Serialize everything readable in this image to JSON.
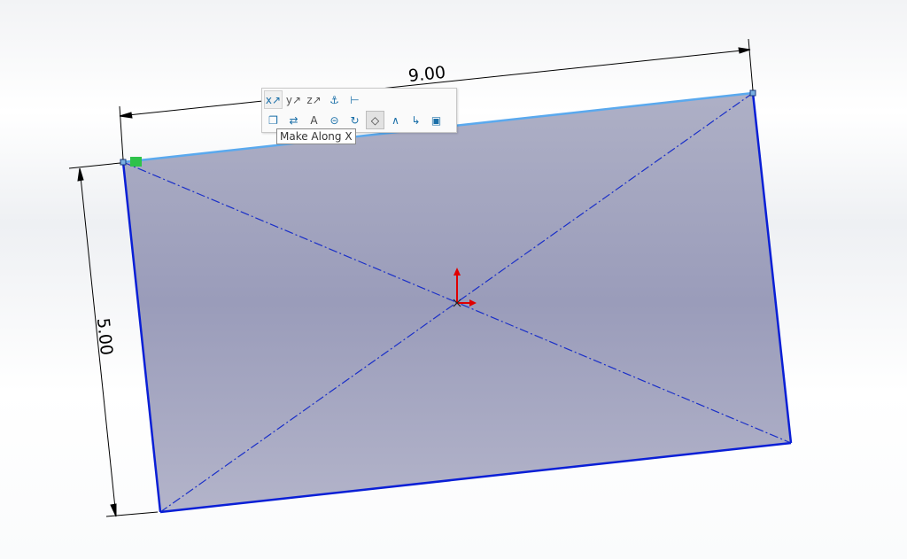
{
  "sketch": {
    "dimension_width": "9.00",
    "dimension_height": "5.00",
    "colors": {
      "face": "#9fa1bd",
      "edge": "#0a1fd6",
      "selected_edge": "#5aa9ee",
      "construction": "#1a2fc8",
      "dimension": "#000000",
      "origin": "#e00000",
      "relation_badge": "#2ec24a"
    }
  },
  "toolbar": {
    "row1": [
      "make-along-x-icon",
      "make-along-y-icon",
      "make-along-z-icon",
      "fix-icon",
      "smart-dimension-icon"
    ],
    "row2": [
      "select-other-icon",
      "convert-entities-icon",
      "add-relation-icon",
      "display-relations-icon",
      "rotate-view-icon",
      "normal-to-icon",
      "sketch-line-icon",
      "offset-entities-icon",
      "view-3d-icon"
    ]
  },
  "tooltip": {
    "text": "Make Along X"
  }
}
